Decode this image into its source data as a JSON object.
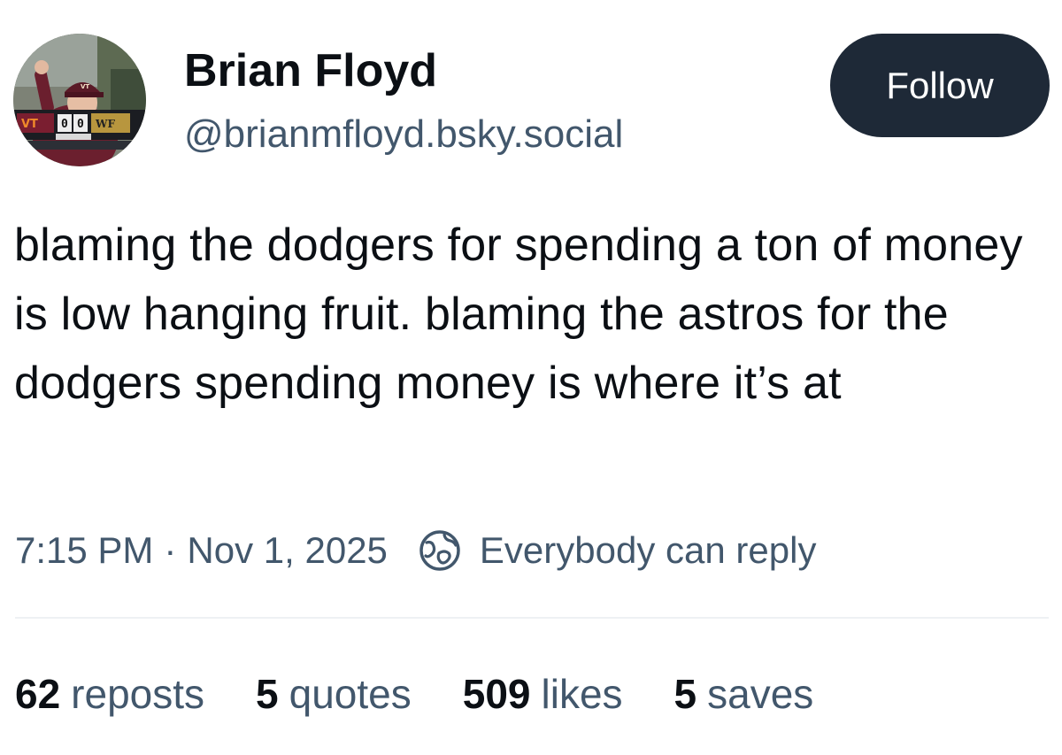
{
  "author": {
    "display_name": "Brian Floyd",
    "handle": "@brianmfloyd.bsky.social",
    "avatar_icon": "avatar-photo",
    "avatar_text": {
      "score_left": "0",
      "score_right": "0",
      "left_team": "VT",
      "right_team": "WF"
    }
  },
  "follow_button": {
    "label": "Follow",
    "background": "#1e2937",
    "text_color": "#ffffff"
  },
  "post": {
    "text": "blaming the dodgers for spending a ton of money is low hanging fruit. blaming the astros for the dodgers spending money is where it’s at"
  },
  "meta": {
    "time": "7:15 PM",
    "separator": "·",
    "date": "Nov 1, 2025",
    "reply_icon": "globe-icon",
    "reply_setting": "Everybody can reply"
  },
  "stats": {
    "reposts": {
      "count": "62",
      "label": "reposts"
    },
    "quotes": {
      "count": "5",
      "label": "quotes"
    },
    "likes": {
      "count": "509",
      "label": "likes"
    },
    "saves": {
      "count": "5",
      "label": "saves"
    }
  },
  "colors": {
    "text_primary": "#0b0f14",
    "text_secondary": "#42576c",
    "divider": "#eef1f4"
  }
}
